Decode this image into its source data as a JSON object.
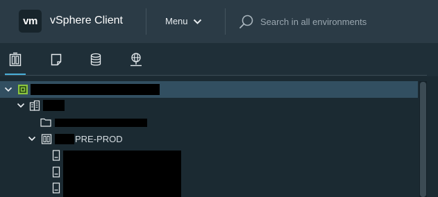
{
  "header": {
    "logo_text": "vm",
    "app_title": "vSphere Client",
    "menu_label": "Menu",
    "search_placeholder": "Search in all environments"
  },
  "tabs": [
    {
      "name": "hosts-and-clusters",
      "icon": "hosts-clusters-icon",
      "active": true
    },
    {
      "name": "vms-and-templates",
      "icon": "vm-templates-icon",
      "active": false
    },
    {
      "name": "storage",
      "icon": "database-icon",
      "active": false
    },
    {
      "name": "networking",
      "icon": "globe-network-icon",
      "active": false
    }
  ],
  "tree": {
    "nodes": [
      {
        "type": "vcenter",
        "icon": "vcenter-icon",
        "label": "",
        "redacted": true,
        "expanded": true,
        "selected": true
      },
      {
        "type": "datacenter",
        "icon": "datacenter-icon",
        "label": "",
        "redacted": true,
        "expanded": true
      },
      {
        "type": "folder",
        "icon": "folder-icon",
        "label": "",
        "redacted": true
      },
      {
        "type": "cluster",
        "icon": "cluster-icon",
        "label": "PRE-PROD",
        "redacted_prefix": true,
        "expanded": true
      },
      {
        "type": "host",
        "icon": "host-icon",
        "label": "",
        "redacted": true
      },
      {
        "type": "host",
        "icon": "host-icon",
        "label": "",
        "redacted": true
      },
      {
        "type": "host",
        "icon": "host-icon",
        "label": "",
        "redacted": true
      }
    ]
  },
  "colors": {
    "header_bg": "#2b3b46",
    "body_bg": "#1b2a32",
    "accent": "#49afd9",
    "selected_row": "#324f61",
    "vcenter_icon": "#8cc63f"
  }
}
